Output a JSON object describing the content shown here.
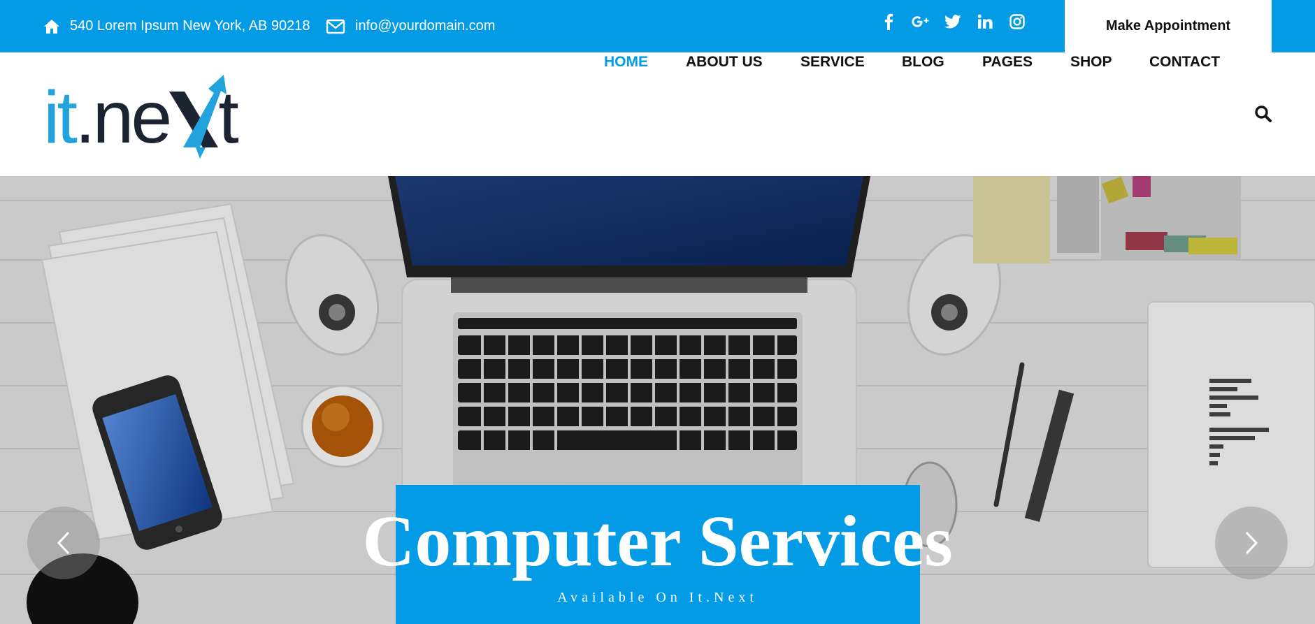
{
  "topbar": {
    "address": "540 Lorem Ipsum New York, AB 90218",
    "email": "info@yourdomain.com",
    "appointment_label": "Make Appointment",
    "socials": [
      "facebook-icon",
      "google-plus-icon",
      "twitter-icon",
      "linkedin-icon",
      "instagram-icon"
    ]
  },
  "logo": {
    "part1": "it",
    "part2": ".ne",
    "part3": "t"
  },
  "nav": {
    "items": [
      "HOME",
      "ABOUT US",
      "SERVICE",
      "BLOG",
      "PAGES",
      "SHOP",
      "CONTACT"
    ],
    "active": "HOME"
  },
  "hero": {
    "title": "Computer Services",
    "subtitle": "Available On It.Next"
  },
  "colors": {
    "accent": "#039be5",
    "dark": "#1b2430",
    "logo_blue": "#22a3dd"
  }
}
